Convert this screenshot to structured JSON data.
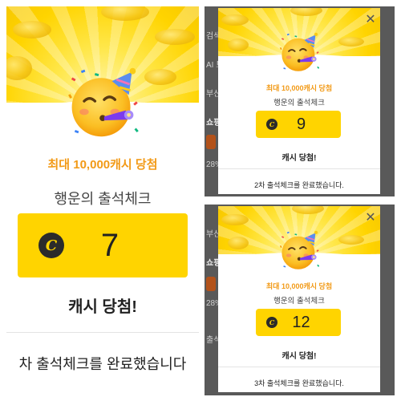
{
  "big": {
    "title": "최대 10,000캐시 당첨",
    "subtitle": "행운의 출석체크",
    "cash_icon": "C",
    "amount": "7",
    "win_label": "캐시 당첨!",
    "footer": "차 출석체크를 완료했습니다"
  },
  "top": {
    "title": "최대 10,000캐시 당첨",
    "subtitle": "행운의 출석체크",
    "cash_icon": "C",
    "amount": "9",
    "win_label": "캐시 당첨!",
    "footer": "2차 출석체크를 완료했습니다.",
    "close": "✕",
    "bg_labels": [
      "검색",
      "AI 트",
      "부산",
      "쇼핑",
      "28%"
    ]
  },
  "bottom": {
    "title": "최대 10,000캐시 당첨",
    "subtitle": "행운의 출석체크",
    "cash_icon": "C",
    "amount": "12",
    "win_label": "캐시 당첨!",
    "footer": "3차 출석체크를 완료했습니다.",
    "close": "✕",
    "bg_labels": [
      "부산",
      "쇼핑",
      "28%",
      "출석"
    ]
  },
  "icons": [
    "party-face-emoji-icon",
    "party-horn-icon",
    "party-hat-icon",
    "cash-coin-icon",
    "close-icon"
  ],
  "colors": {
    "accent_yellow": "#ffd400",
    "title_orange": "#f29a17",
    "dark": "#222222",
    "overlay": "#595959"
  }
}
